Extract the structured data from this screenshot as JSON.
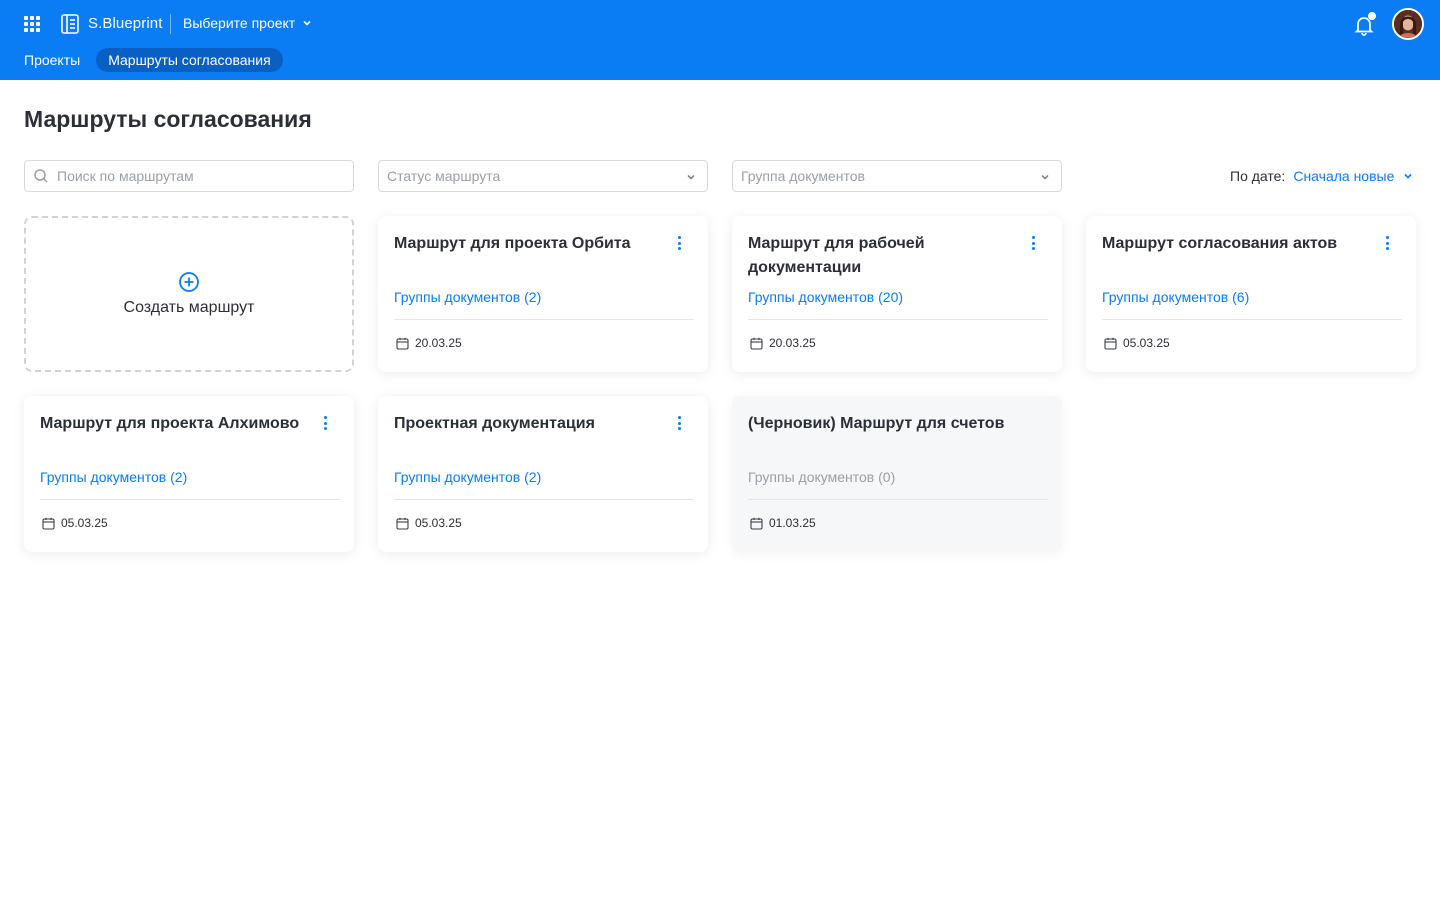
{
  "header": {
    "app_name": "S.Blueprint",
    "project_select": "Выберите проект",
    "nav": [
      {
        "label": "Проекты"
      },
      {
        "label": "Маршруты согласования"
      }
    ]
  },
  "page": {
    "title": "Маршруты согласования"
  },
  "filters": {
    "search_placeholder": "Поиск по маршрутам",
    "status_placeholder": "Статус маршрута",
    "group_placeholder": "Группа документов",
    "sort_label": "По дате:",
    "sort_value": "Сначала новые"
  },
  "create_card": {
    "label": "Создать маршрут"
  },
  "routes": [
    {
      "title": "Маршрут для проекта Орбита",
      "groups": "Группы документов (2)",
      "date": "20.03.25",
      "draft": false
    },
    {
      "title": "Маршрут для рабочей документации",
      "groups": "Группы документов (20)",
      "date": "20.03.25",
      "draft": false
    },
    {
      "title": "Маршрут согласования актов",
      "groups": "Группы документов (6)",
      "date": "05.03.25",
      "draft": false
    },
    {
      "title": "Маршрут для проекта Алхимово",
      "groups": "Группы документов (2)",
      "date": "05.03.25",
      "draft": false
    },
    {
      "title": "Проектная документация",
      "groups": "Группы документов (2)",
      "date": "05.03.25",
      "draft": false
    },
    {
      "title": "(Черновик) Маршрут для счетов",
      "groups": "Группы документов (0)",
      "date": "01.03.25",
      "draft": true
    }
  ],
  "colors": {
    "brand": "#0a7cf4",
    "nav_active": "#0a5fc4"
  }
}
